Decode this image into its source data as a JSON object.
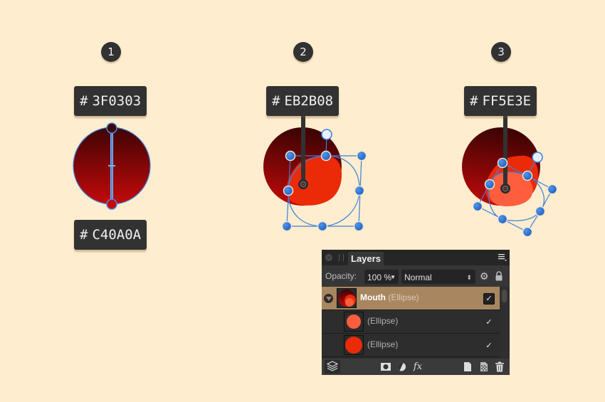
{
  "colors": {
    "background": "#feedcf",
    "selection_blue": "#2f74d0",
    "gradient_top": "#3F0303",
    "gradient_bottom": "#C40A0A",
    "ellipse_mid": "#EB2B08",
    "ellipse_light": "#FF5E3E",
    "panel_selected": "#a88660"
  },
  "steps": [
    {
      "number": "1",
      "hex_labels": [
        {
          "hash": "#",
          "value": "3F0303"
        },
        {
          "hash": "#",
          "value": "C40A0A"
        }
      ]
    },
    {
      "number": "2",
      "hex_labels": [
        {
          "hash": "#",
          "value": "EB2B08"
        }
      ]
    },
    {
      "number": "3",
      "hex_labels": [
        {
          "hash": "#",
          "value": "FF5E3E"
        }
      ]
    }
  ],
  "layers_panel": {
    "tab_label": "Layers",
    "close_icon": "close-icon",
    "menu_icon": "panel-menu-icon",
    "opacity_label": "Opacity:",
    "opacity_value": "100 %",
    "blend_mode": "Normal",
    "layers": [
      {
        "name": "Mouth",
        "type": "(Ellipse)",
        "selected": true,
        "expanded": true,
        "visible": true
      },
      {
        "name": "",
        "type": "(Ellipse)",
        "selected": false,
        "visible": true
      },
      {
        "name": "",
        "type": "(Ellipse)",
        "selected": false,
        "visible": true
      }
    ],
    "check_mark": "✓",
    "footer_icons": [
      "layers-stack-icon",
      "mask-icon",
      "adjustment-icon",
      "fx-icon",
      "new-layer-icon",
      "new-pixel-layer-icon",
      "trash-icon"
    ],
    "fx_label": "fx"
  }
}
